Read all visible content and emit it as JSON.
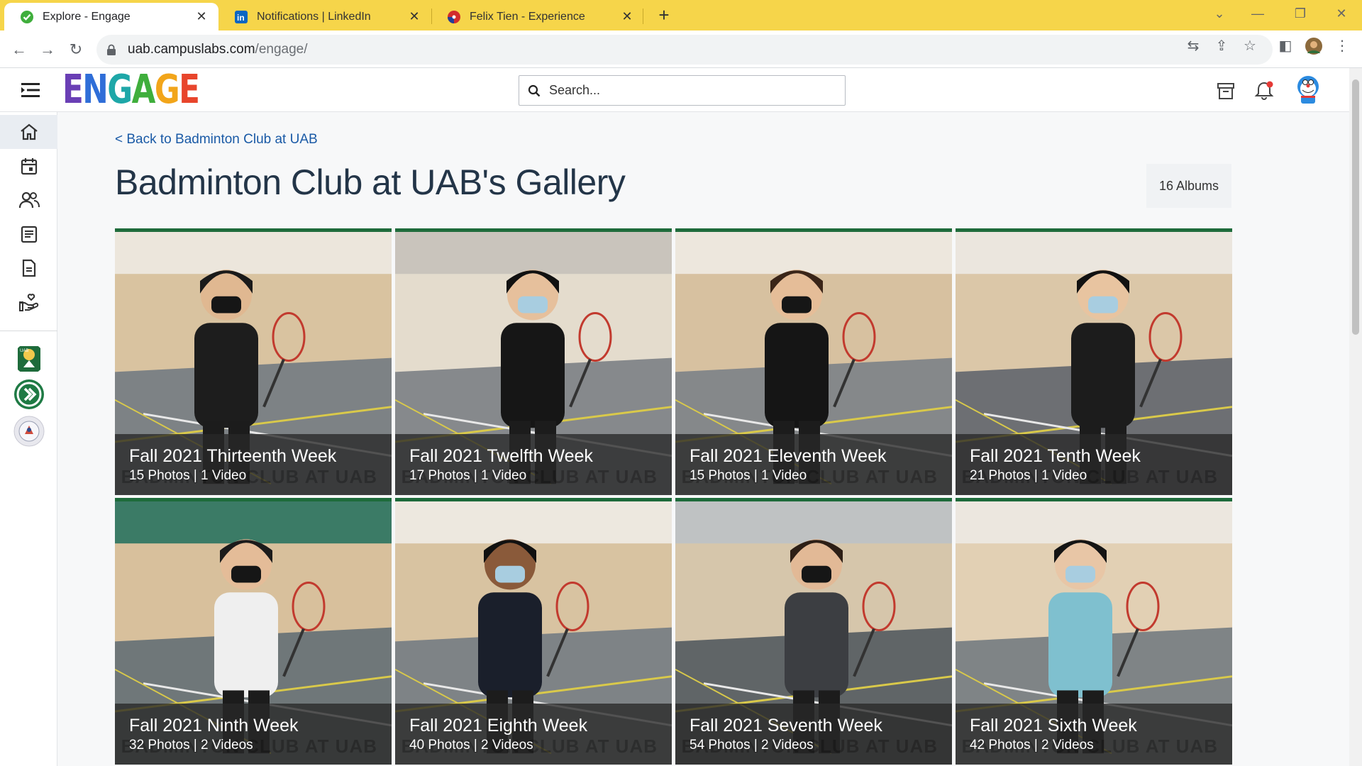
{
  "browser": {
    "tabs": [
      {
        "title": "Explore - Engage",
        "favicon": "engage-check-icon",
        "active": true
      },
      {
        "title": "Notifications | LinkedIn",
        "favicon": "linkedin-icon",
        "active": false
      },
      {
        "title": "Felix Tien - Experience",
        "favicon": "flag-globe-icon",
        "active": false
      }
    ],
    "new_tab_label": "+",
    "url_host": "uab.campuslabs.com",
    "url_path": "/engage/"
  },
  "header": {
    "logo_text": "ENGAGE",
    "logo_colors": [
      "#6a3fb5",
      "#2f6ed8",
      "#1ea7a8",
      "#3fae3c",
      "#f2a51a",
      "#e8452c"
    ],
    "search_placeholder": "Search...",
    "accent_notification": "#e53935"
  },
  "sidebar": {
    "items": [
      {
        "name": "home",
        "active": true
      },
      {
        "name": "events",
        "active": false
      },
      {
        "name": "organizations",
        "active": false
      },
      {
        "name": "news",
        "active": false
      },
      {
        "name": "forms",
        "active": false
      },
      {
        "name": "service",
        "active": false
      }
    ],
    "orgs": [
      "badminton-club-logo",
      "engage-green-logo",
      "uab-seal-logo"
    ]
  },
  "page": {
    "back_link": "< Back to Badminton Club at UAB",
    "title": "Badminton Club at UAB's Gallery",
    "album_count": "16 Albums",
    "accent_color": "#1e6b3b",
    "watermark": "BADMINTON CLUB AT UAB"
  },
  "albums": [
    {
      "name": "Fall 2021 Thirteenth Week",
      "meta": "15 Photos | 1 Video"
    },
    {
      "name": "Fall 2021 Twelfth Week",
      "meta": "17 Photos | 1 Video"
    },
    {
      "name": "Fall 2021 Eleventh Week",
      "meta": "15 Photos | 1 Video"
    },
    {
      "name": "Fall 2021 Tenth Week",
      "meta": "21 Photos | 1 Video"
    },
    {
      "name": "Fall 2021 Ninth Week",
      "meta": "32 Photos | 2 Videos"
    },
    {
      "name": "Fall 2021 Eighth Week",
      "meta": "40 Photos | 2 Videos"
    },
    {
      "name": "Fall 2021 Seventh Week",
      "meta": "54 Photos | 2 Videos"
    },
    {
      "name": "Fall 2021 Sixth Week",
      "meta": "42 Photos | 2 Videos"
    }
  ]
}
